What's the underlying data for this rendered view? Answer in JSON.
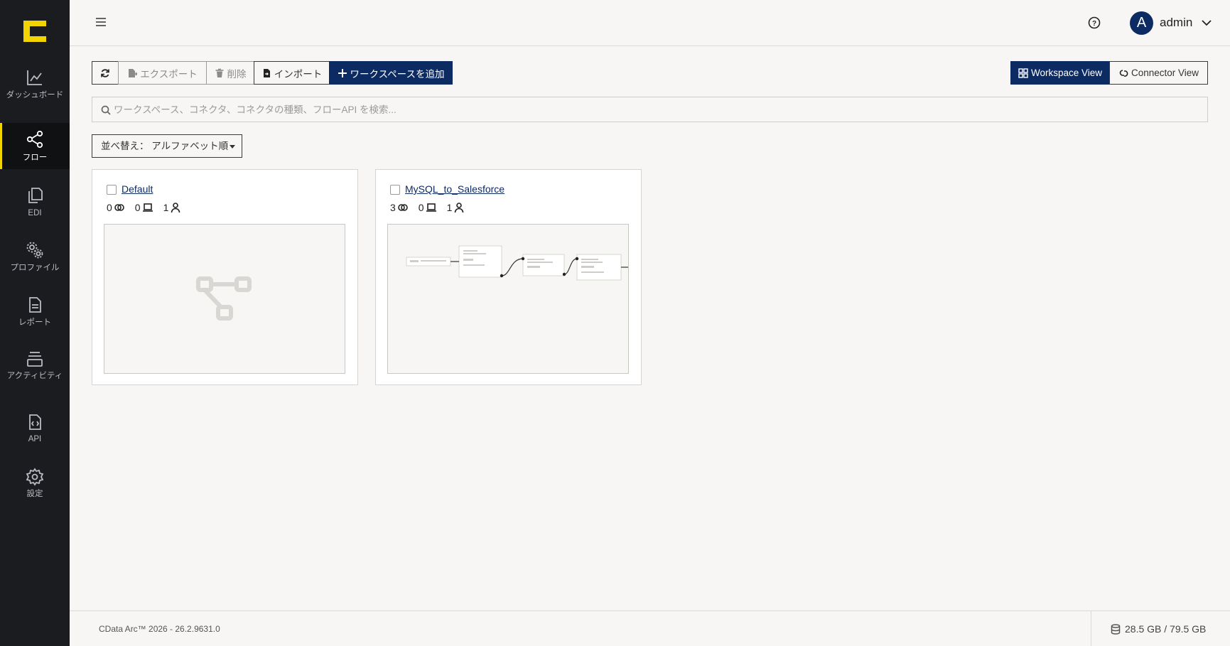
{
  "sidebar": {
    "items": [
      {
        "label": "ダッシュボード",
        "icon": "chart-line-icon"
      },
      {
        "label": "フロー",
        "icon": "share-nodes-icon",
        "active": true
      },
      {
        "label": "EDI",
        "icon": "documents-icon"
      },
      {
        "label": "プロファイル",
        "icon": "gears-icon"
      },
      {
        "label": "レポート",
        "icon": "report-icon"
      },
      {
        "label": "アクティビティ",
        "icon": "layers-icon"
      },
      {
        "label": "API",
        "icon": "api-file-icon"
      },
      {
        "label": "設定",
        "icon": "gear-icon"
      }
    ]
  },
  "header": {
    "user_initial": "A",
    "user_name": "admin"
  },
  "toolbar": {
    "export_label": "エクスポート",
    "delete_label": "削除",
    "import_label": "インポート",
    "add_workspace_label": "ワークスペースを追加",
    "workspace_view_label": "Workspace View",
    "connector_view_label": "Connector View"
  },
  "search": {
    "placeholder": "ワークスペース、コネクタ、コネクタの種類、フローAPI を検索..."
  },
  "sort": {
    "label": "並べ替え： アルファベット順"
  },
  "workspaces": [
    {
      "name": "Default",
      "connectors": "0",
      "devices": "0",
      "users": "1"
    },
    {
      "name": "MySQL_to_Salesforce",
      "connectors": "3",
      "devices": "0",
      "users": "1"
    }
  ],
  "footer": {
    "copyright": "CData Arc™ 2026 - 26.2.9631.0",
    "storage": "28.5 GB / 79.5 GB"
  },
  "colors": {
    "sidebar_bg": "#1b1c1f",
    "accent_yellow": "#f2d400",
    "primary_navy": "#0d2b63"
  }
}
